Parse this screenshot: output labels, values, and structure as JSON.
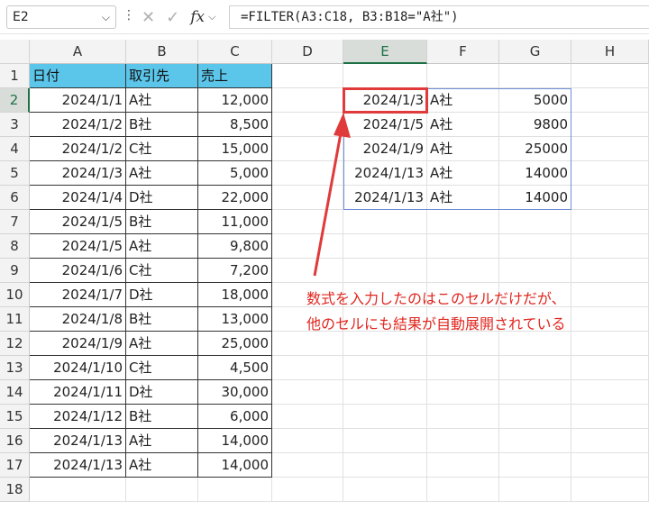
{
  "formula_bar": {
    "name_box": "E2",
    "fx_label": "fx",
    "formula": "=FILTER(A3:C18, B3:B18=\"A社\")"
  },
  "columns": [
    "A",
    "B",
    "C",
    "D",
    "E",
    "F",
    "G",
    "H"
  ],
  "selected_column": "E",
  "rows": [
    "1",
    "2",
    "3",
    "4",
    "5",
    "6",
    "7",
    "8",
    "9",
    "10",
    "11",
    "12",
    "13",
    "14",
    "15",
    "16",
    "17",
    "18"
  ],
  "selected_row": "2",
  "table": {
    "headers": [
      "日付",
      "取引先",
      "売上"
    ],
    "rows": [
      [
        "2024/1/1",
        "A社",
        "12,000"
      ],
      [
        "2024/1/2",
        "B社",
        "8,500"
      ],
      [
        "2024/1/2",
        "C社",
        "15,000"
      ],
      [
        "2024/1/3",
        "A社",
        "5,000"
      ],
      [
        "2024/1/4",
        "D社",
        "22,000"
      ],
      [
        "2024/1/5",
        "B社",
        "11,000"
      ],
      [
        "2024/1/5",
        "A社",
        "9,800"
      ],
      [
        "2024/1/6",
        "C社",
        "7,200"
      ],
      [
        "2024/1/7",
        "D社",
        "18,000"
      ],
      [
        "2024/1/8",
        "B社",
        "13,000"
      ],
      [
        "2024/1/9",
        "A社",
        "25,000"
      ],
      [
        "2024/1/10",
        "C社",
        "4,500"
      ],
      [
        "2024/1/11",
        "D社",
        "30,000"
      ],
      [
        "2024/1/12",
        "B社",
        "6,000"
      ],
      [
        "2024/1/13",
        "A社",
        "14,000"
      ],
      [
        "2024/1/13",
        "A社",
        "14,000"
      ]
    ]
  },
  "spill": [
    [
      "2024/1/3",
      "A社",
      "5000"
    ],
    [
      "2024/1/5",
      "A社",
      "9800"
    ],
    [
      "2024/1/9",
      "A社",
      "25000"
    ],
    [
      "2024/1/13",
      "A社",
      "14000"
    ],
    [
      "2024/1/13",
      "A社",
      "14000"
    ]
  ],
  "annotation": {
    "line1": "数式を入力したのはこのセルだけだが、",
    "line2": "他のセルにも結果が自動展開されている"
  },
  "colors": {
    "header_fill": "#5bc5ea",
    "annotation": "#e0261f",
    "spill_border": "#6e8ed6"
  }
}
